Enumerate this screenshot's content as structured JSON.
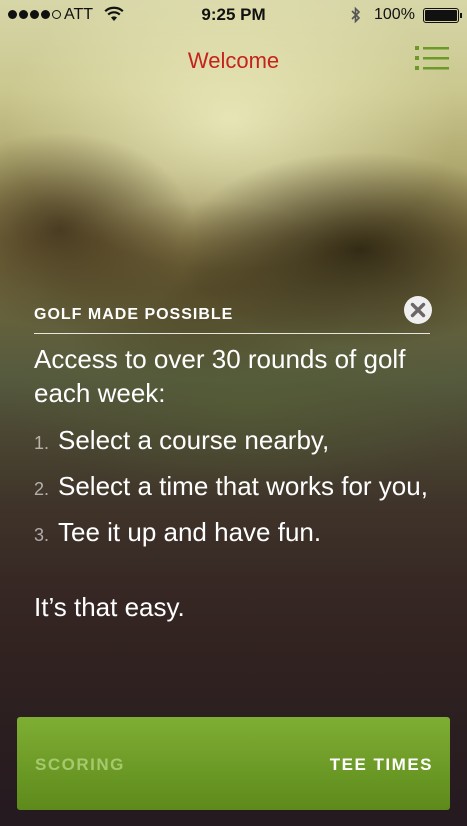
{
  "status_bar": {
    "carrier": "ATT",
    "time": "9:25 PM",
    "battery": "100%"
  },
  "nav": {
    "title": "Welcome",
    "title_color": "#c4231d",
    "menu_icon": "list-icon",
    "accent_color": "#6a9a28"
  },
  "content": {
    "eyebrow": "GOLF MADE POSSIBLE",
    "intro": "Access to over 30 rounds of golf each week:",
    "steps": [
      {
        "num": "1.",
        "text": "Select a course nearby,"
      },
      {
        "num": "2.",
        "text": "Select a  time that works for you,"
      },
      {
        "num": "3.",
        "text": "Tee it up and have fun."
      }
    ],
    "outro": "It’s that easy.",
    "close_icon": "close-icon"
  },
  "bottom_bar": {
    "tabs": [
      {
        "label": "SCORING",
        "selected": false
      },
      {
        "label": "TEE TIMES",
        "selected": true
      }
    ]
  }
}
